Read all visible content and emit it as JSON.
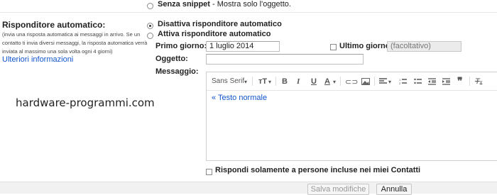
{
  "snippets_option": {
    "label": "Senza snippet",
    "desc": " - Mostra solo l'oggetto."
  },
  "autoreply": {
    "title": "Risponditore automatico:",
    "help_lines": [
      "(invia una risposta automatica ai messaggi in arrivo. Se un",
      "contatto ti invia diversi messaggi, la risposta automatica verrà",
      "inviata al massimo una sola volta ogni 4 giorni)"
    ],
    "more_info": "Ulteriori informazioni",
    "off_label": "Disattiva risponditore automatico",
    "on_label": "Attiva risponditore automatico",
    "first_day_label": "Primo giorno:",
    "first_day_value": "1 luglio 2014",
    "last_day_label": "Ultimo giorno:",
    "last_day_placeholder": "(facoltativo)",
    "subject_label": "Oggetto:",
    "message_label": "Messaggio:",
    "font_name": "Sans Serif",
    "plain_text_link": "« Testo normale",
    "contacts_only_label": "Rispondi solamente a persone incluse nei miei Contatti"
  },
  "toolbar_icons": [
    "font-size-icon",
    "bold-icon",
    "italic-icon",
    "underline-icon",
    "text-color-icon",
    "link-icon",
    "image-icon",
    "align-icon",
    "numbered-list-icon",
    "bulleted-list-icon",
    "indent-less-icon",
    "indent-more-icon",
    "quote-icon",
    "remove-formatting-icon"
  ],
  "watermark": "hardware-programmi.com",
  "buttons": {
    "save": "Salva modifiche",
    "cancel": "Annulla"
  }
}
